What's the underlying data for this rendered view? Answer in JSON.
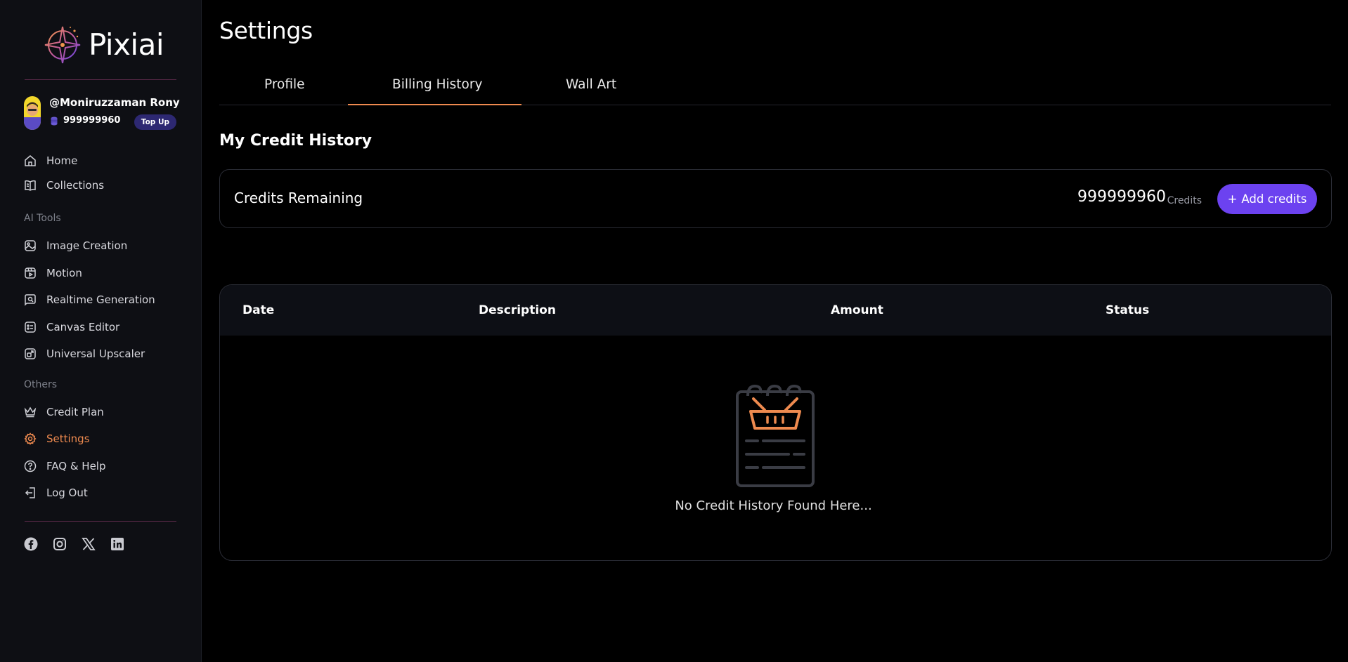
{
  "brand": {
    "name": "Pixiai"
  },
  "user": {
    "handle": "@Moniruzzaman Rony",
    "credits": "999999960",
    "topup_label": "Top Up"
  },
  "nav": {
    "main": [
      {
        "label": "Home",
        "icon": "home-icon"
      },
      {
        "label": "Collections",
        "icon": "book-icon"
      }
    ],
    "ai_tools_title": "AI Tools",
    "ai_tools": [
      {
        "label": "Image Creation",
        "icon": "image-icon"
      },
      {
        "label": "Motion",
        "icon": "video-icon"
      },
      {
        "label": "Realtime Generation",
        "icon": "realtime-icon"
      },
      {
        "label": "Canvas Editor",
        "icon": "canvas-icon"
      },
      {
        "label": "Universal Upscaler",
        "icon": "upscale-icon"
      }
    ],
    "others_title": "Others",
    "others": [
      {
        "label": "Credit Plan",
        "icon": "crown-icon"
      },
      {
        "label": "Settings",
        "icon": "gear-icon",
        "active": true
      },
      {
        "label": "FAQ & Help",
        "icon": "help-icon"
      },
      {
        "label": "Log Out",
        "icon": "logout-icon"
      }
    ]
  },
  "socials": [
    "facebook-icon",
    "instagram-icon",
    "x-icon",
    "linkedin-icon"
  ],
  "page": {
    "title": "Settings",
    "tabs": [
      {
        "label": "Profile"
      },
      {
        "label": "Billing History",
        "active": true
      },
      {
        "label": "Wall Art"
      }
    ],
    "section_title": "My Credit History",
    "credits_card": {
      "label": "Credits Remaining",
      "value": "999999960",
      "unit": "Credits",
      "add_button": "Add credits"
    },
    "table": {
      "columns": [
        "Date",
        "Description",
        "Amount",
        "Status"
      ],
      "rows": [],
      "empty_message": "No Credit History Found Here..."
    }
  },
  "colors": {
    "accent_orange": "#ee8a4f",
    "accent_purple": "#6c42f0",
    "background": "#000000",
    "sidebar": "#0e0f14"
  }
}
